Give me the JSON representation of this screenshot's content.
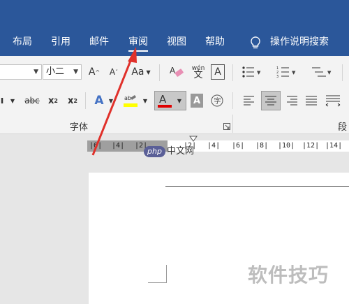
{
  "tabs": [
    "布局",
    "引用",
    "邮件",
    "审阅",
    "视图",
    "帮助"
  ],
  "search_label": "操作说明搜索",
  "font": {
    "size": "小二",
    "group_label": "字体",
    "aa_label": "Aa",
    "phonetic_top": "wén",
    "phonetic_bottom": "文"
  },
  "paragraph_group_label": "段",
  "ruler": [
    "6",
    "4",
    "2",
    "2",
    "4",
    "6",
    "8",
    "10",
    "12",
    "14"
  ],
  "watermark_text": "软件技巧",
  "logo_php": "php",
  "logo_text": "中文网",
  "colors": {
    "ribbon_blue": "#2b579a",
    "font_color_red": "#e00000",
    "highlight_yellow": "#ffff00",
    "arrow_red": "#e0302a"
  }
}
